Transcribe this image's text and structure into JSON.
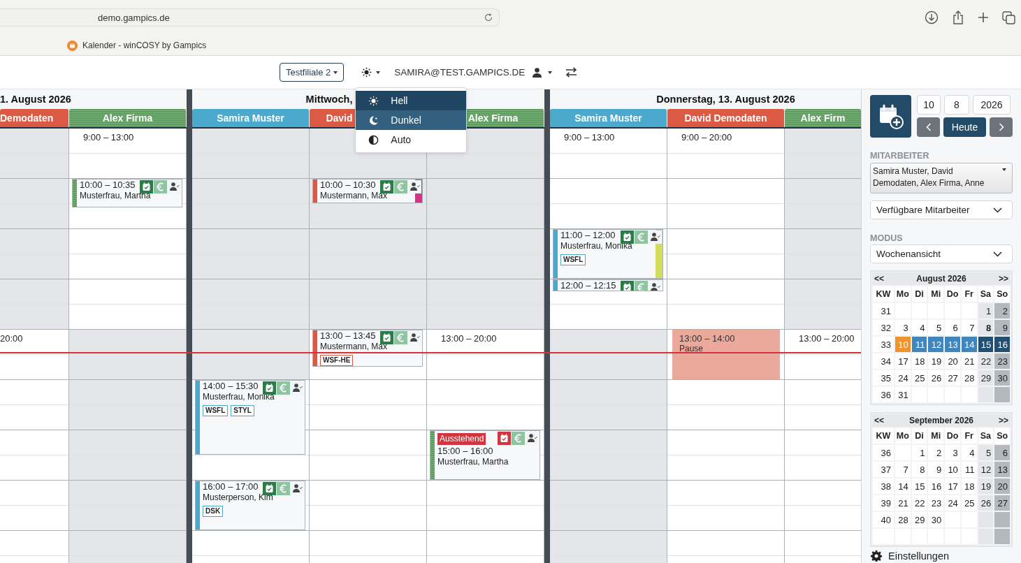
{
  "browser": {
    "url": "demo.gampics.de",
    "tab_title": "Kalender - winCOSY by Gampics"
  },
  "topbar": {
    "branch": "Testfiliale 2",
    "user": "SAMIRA@TEST.GAMPICS.DE",
    "theme_menu_open": true,
    "theme_menu": [
      {
        "kind": "light",
        "label": "Hell",
        "selected": true,
        "hovered": false
      },
      {
        "kind": "dark",
        "label": "Dunkel",
        "selected": false,
        "hovered": true
      },
      {
        "kind": "auto",
        "label": "Auto",
        "selected": false,
        "hovered": false
      }
    ]
  },
  "calendar": {
    "days": [
      {
        "title": "1. August 2026",
        "columns": [
          {
            "name": "Demodaten",
            "color": "#dc5a43",
            "striped": false,
            "cells": [
              {
                "open": false
              },
              {
                "open": false
              },
              {
                "open": false
              },
              {
                "open": false
              },
              {
                "open": false
              },
              {
                "open": false
              },
              {
                "open": false
              },
              {
                "open": false
              },
              {
                "open": true,
                "shift": "20:00"
              },
              {
                "open": true
              },
              {
                "open": true
              },
              {
                "open": true
              },
              {
                "open": true
              },
              {
                "open": true
              },
              {
                "open": true
              },
              {
                "open": true
              },
              {
                "open": true
              }
            ]
          },
          {
            "name": "Alex Firma",
            "color": "#5a9a5a",
            "striped": true,
            "cells": [
              {
                "open": true,
                "shift": "9:00 – 13:00"
              },
              {
                "open": true
              },
              {
                "open": true
              },
              {
                "open": true
              },
              {
                "open": true
              },
              {
                "open": true
              },
              {
                "open": true
              },
              {
                "open": true
              },
              {
                "open": false
              },
              {
                "open": false
              },
              {
                "open": false
              },
              {
                "open": false
              },
              {
                "open": false
              },
              {
                "open": false
              },
              {
                "open": false
              },
              {
                "open": false
              },
              {
                "open": false
              }
            ],
            "events": [
              {
                "kind": "appointment",
                "time": "10:00 – 10:35",
                "name": "Musterfrau, Martha",
                "confirmed": true
              }
            ]
          }
        ]
      },
      {
        "title": "Mittwoch,",
        "columns": [
          {
            "name": "Samira Muster",
            "color": "#4aa9cc",
            "striped": false,
            "cells": [
              {
                "open": false
              },
              {
                "open": false
              },
              {
                "open": false
              },
              {
                "open": false
              },
              {
                "open": false
              },
              {
                "open": false
              },
              {
                "open": false
              },
              {
                "open": false
              },
              {
                "open": false
              },
              {
                "open": false
              },
              {
                "open": true
              },
              {
                "open": true
              },
              {
                "open": true
              },
              {
                "open": true
              },
              {
                "open": true
              },
              {
                "open": true
              },
              {
                "open": true
              }
            ],
            "events": [
              {
                "kind": "appointment",
                "time": "14:00 – 15:30",
                "name": "Musterfrau, Monika",
                "confirmed": true,
                "tags": [
                  {
                    "text": "WSFL"
                  },
                  {
                    "text": "STYL"
                  }
                ]
              },
              {
                "kind": "appointment",
                "time": "16:00 – 17:00",
                "name": "Musterperson, Kim",
                "confirmed": true,
                "tags": [
                  {
                    "text": "DSK"
                  }
                ]
              }
            ]
          },
          {
            "name": "David",
            "color": "#dc5a43",
            "striped": false,
            "cells": [
              {
                "open": false
              },
              {
                "open": false
              },
              {
                "open": false
              },
              {
                "open": false
              },
              {
                "open": false
              },
              {
                "open": false
              },
              {
                "open": false
              },
              {
                "open": false
              },
              {
                "open": true
              },
              {
                "open": true
              },
              {
                "open": true
              },
              {
                "open": true
              },
              {
                "open": true
              },
              {
                "open": true
              },
              {
                "open": true
              },
              {
                "open": true
              },
              {
                "open": true
              }
            ],
            "events": [
              {
                "kind": "appointment",
                "time": "10:00 – 10:30",
                "name": "Mustermann, Max",
                "confirmed": true,
                "color": "#d63384"
              },
              {
                "kind": "appointment",
                "time": "13:00 – 13:45",
                "name": "Mustermann, Max",
                "confirmed": true,
                "tags": [
                  {
                    "text": "WSF-HE"
                  }
                ]
              }
            ]
          },
          {
            "name": "Alex Firma",
            "color": "#5a9a5a",
            "striped": true,
            "cells": [
              {
                "open": false
              },
              {
                "open": false
              },
              {
                "open": false
              },
              {
                "open": false
              },
              {
                "open": false
              },
              {
                "open": false
              },
              {
                "open": false
              },
              {
                "open": false
              },
              {
                "open": true,
                "shift": "13:00 – 20:00"
              },
              {
                "open": true
              },
              {
                "open": true
              },
              {
                "open": true
              },
              {
                "open": true
              },
              {
                "open": true
              },
              {
                "open": true
              },
              {
                "open": true
              },
              {
                "open": true
              }
            ],
            "events": [
              {
                "kind": "appointment",
                "status": "Ausstehend",
                "time": "15:00 – 16:00",
                "name": "Musterfrau, Martha",
                "confirmed": false
              }
            ]
          }
        ]
      },
      {
        "title": "Donnerstag, 13. August 2026",
        "columns": [
          {
            "name": "Samira Muster",
            "color": "#4aa9cc",
            "striped": false,
            "cells": [
              {
                "open": true,
                "shift": "9:00 – 13:00"
              },
              {
                "open": true
              },
              {
                "open": true
              },
              {
                "open": true
              },
              {
                "open": true
              },
              {
                "open": true
              },
              {
                "open": true
              },
              {
                "open": true
              },
              {
                "open": false
              },
              {
                "open": false
              },
              {
                "open": false
              },
              {
                "open": false
              },
              {
                "open": false
              },
              {
                "open": false
              },
              {
                "open": false
              },
              {
                "open": false
              },
              {
                "open": false
              }
            ],
            "events": [
              {
                "kind": "appointment",
                "time": "11:00 – 12:00",
                "name": "Musterfrau, Monika",
                "confirmed": true,
                "color": "#d4dc5c",
                "tags": [
                  {
                    "text": "WSFL"
                  }
                ]
              },
              {
                "kind": "appointment",
                "time": "12:00 – 12:15",
                "confirmed": true
              }
            ]
          },
          {
            "name": "David Demodaten",
            "color": "#dc5a43",
            "striped": false,
            "cells": [
              {
                "open": true,
                "shift": "9:00 – 20:00"
              },
              {
                "open": true
              },
              {
                "open": true
              },
              {
                "open": true
              },
              {
                "open": true
              },
              {
                "open": true
              },
              {
                "open": true
              },
              {
                "open": true
              },
              {
                "open": true
              },
              {
                "open": true
              },
              {
                "open": true
              },
              {
                "open": true
              },
              {
                "open": true
              },
              {
                "open": true
              },
              {
                "open": true
              },
              {
                "open": true
              },
              {
                "open": true
              }
            ],
            "events": [
              {
                "kind": "break",
                "time": "13:00 – 14:00",
                "name": "Pause"
              }
            ]
          },
          {
            "name": "Alex Firm",
            "color": "#5a9a5a",
            "striped": true,
            "cells": [
              {
                "open": false
              },
              {
                "open": false
              },
              {
                "open": false
              },
              {
                "open": false
              },
              {
                "open": false
              },
              {
                "open": false
              },
              {
                "open": false
              },
              {
                "open": false
              },
              {
                "open": true,
                "shift": "13:00 – 20:00"
              },
              {
                "open": true
              },
              {
                "open": true
              },
              {
                "open": true
              },
              {
                "open": true
              },
              {
                "open": true
              },
              {
                "open": true
              },
              {
                "open": true
              },
              {
                "open": true
              }
            ]
          }
        ]
      }
    ]
  },
  "sidebar": {
    "date_fields": [
      {
        "value": "10"
      },
      {
        "value": "8"
      },
      {
        "value": "2026"
      }
    ],
    "today_button": "Heute",
    "staff_label": "MITARBEITER",
    "staff_select": "Samira Muster, David Demodaten, Alex Firma, Anne",
    "available_select": "Verfügbare Mitarbeiter",
    "mode_label": "MODUS",
    "mode_select": "Wochenansicht",
    "months": [
      {
        "title": "August 2026",
        "prev": "<<",
        "next": ">>",
        "weekdays": [
          "KW",
          "Mo",
          "Di",
          "Mi",
          "Do",
          "Fr",
          "Sa",
          "So"
        ],
        "weeks": [
          {
            "week": "31",
            "selected": false,
            "days": [
              {
                "kind": "blank"
              },
              {
                "kind": "blank"
              },
              {
                "kind": "blank"
              },
              {
                "kind": "blank"
              },
              {
                "kind": "blank"
              },
              {
                "kind": "day",
                "day": "1"
              },
              {
                "kind": "day",
                "day": "2"
              }
            ]
          },
          {
            "week": "32",
            "selected": false,
            "days": [
              {
                "kind": "day",
                "day": "3"
              },
              {
                "kind": "day",
                "day": "4"
              },
              {
                "kind": "day",
                "day": "5"
              },
              {
                "kind": "day",
                "day": "6"
              },
              {
                "kind": "day",
                "day": "7"
              },
              {
                "kind": "bold",
                "day": "8"
              },
              {
                "kind": "day",
                "day": "9"
              }
            ]
          },
          {
            "week": "33",
            "selected": true,
            "days": [
              {
                "kind": "today",
                "day": "10"
              },
              {
                "kind": "day",
                "day": "11"
              },
              {
                "kind": "day",
                "day": "12"
              },
              {
                "kind": "day",
                "day": "13"
              },
              {
                "kind": "day",
                "day": "14"
              },
              {
                "kind": "day",
                "day": "15"
              },
              {
                "kind": "day",
                "day": "16"
              }
            ]
          },
          {
            "week": "34",
            "selected": false,
            "days": [
              {
                "kind": "day",
                "day": "17"
              },
              {
                "kind": "day",
                "day": "18"
              },
              {
                "kind": "day",
                "day": "19"
              },
              {
                "kind": "day",
                "day": "20"
              },
              {
                "kind": "day",
                "day": "21"
              },
              {
                "kind": "day",
                "day": "22"
              },
              {
                "kind": "day",
                "day": "23"
              }
            ]
          },
          {
            "week": "35",
            "selected": false,
            "days": [
              {
                "kind": "day",
                "day": "24"
              },
              {
                "kind": "day",
                "day": "25"
              },
              {
                "kind": "day",
                "day": "26"
              },
              {
                "kind": "day",
                "day": "27"
              },
              {
                "kind": "day",
                "day": "28"
              },
              {
                "kind": "day",
                "day": "29"
              },
              {
                "kind": "day",
                "day": "30"
              }
            ]
          },
          {
            "week": "36",
            "selected": false,
            "days": [
              {
                "kind": "day",
                "day": "31"
              },
              {
                "kind": "blank"
              },
              {
                "kind": "blank"
              },
              {
                "kind": "blank"
              },
              {
                "kind": "blank"
              },
              {
                "kind": "blank"
              },
              {
                "kind": "blank"
              }
            ]
          }
        ]
      },
      {
        "title": "September 2026",
        "prev": "<<",
        "next": ">>",
        "weekdays": [
          "KW",
          "Mo",
          "Di",
          "Mi",
          "Do",
          "Fr",
          "Sa",
          "So"
        ],
        "weeks": [
          {
            "week": "36",
            "selected": false,
            "days": [
              {
                "kind": "blank"
              },
              {
                "kind": "day",
                "day": "1"
              },
              {
                "kind": "day",
                "day": "2"
              },
              {
                "kind": "day",
                "day": "3"
              },
              {
                "kind": "day",
                "day": "4"
              },
              {
                "kind": "day",
                "day": "5"
              },
              {
                "kind": "day",
                "day": "6"
              }
            ]
          },
          {
            "week": "37",
            "selected": false,
            "days": [
              {
                "kind": "day",
                "day": "7"
              },
              {
                "kind": "day",
                "day": "8"
              },
              {
                "kind": "day",
                "day": "9"
              },
              {
                "kind": "day",
                "day": "10"
              },
              {
                "kind": "day",
                "day": "11"
              },
              {
                "kind": "day",
                "day": "12"
              },
              {
                "kind": "day",
                "day": "13"
              }
            ]
          },
          {
            "week": "38",
            "selected": false,
            "days": [
              {
                "kind": "day",
                "day": "14"
              },
              {
                "kind": "day",
                "day": "15"
              },
              {
                "kind": "day",
                "day": "16"
              },
              {
                "kind": "day",
                "day": "17"
              },
              {
                "kind": "day",
                "day": "18"
              },
              {
                "kind": "day",
                "day": "19"
              },
              {
                "kind": "day",
                "day": "20"
              }
            ]
          },
          {
            "week": "39",
            "selected": false,
            "days": [
              {
                "kind": "day",
                "day": "21"
              },
              {
                "kind": "day",
                "day": "22"
              },
              {
                "kind": "day",
                "day": "23"
              },
              {
                "kind": "day",
                "day": "24"
              },
              {
                "kind": "day",
                "day": "25"
              },
              {
                "kind": "day",
                "day": "26"
              },
              {
                "kind": "day",
                "day": "27"
              }
            ]
          },
          {
            "week": "40",
            "selected": false,
            "days": [
              {
                "kind": "day",
                "day": "28"
              },
              {
                "kind": "day",
                "day": "29"
              },
              {
                "kind": "day",
                "day": "30"
              },
              {
                "kind": "blank"
              },
              {
                "kind": "blank"
              },
              {
                "kind": "blank"
              },
              {
                "kind": "blank"
              }
            ]
          },
          {
            "selected": false,
            "days": [
              {
                "kind": "blank"
              },
              {
                "kind": "blank"
              },
              {
                "kind": "blank"
              },
              {
                "kind": "blank"
              },
              {
                "kind": "blank"
              },
              {
                "kind": "blank"
              },
              {
                "kind": "blank"
              }
            ]
          }
        ]
      }
    ],
    "settings": "Einstellungen"
  }
}
